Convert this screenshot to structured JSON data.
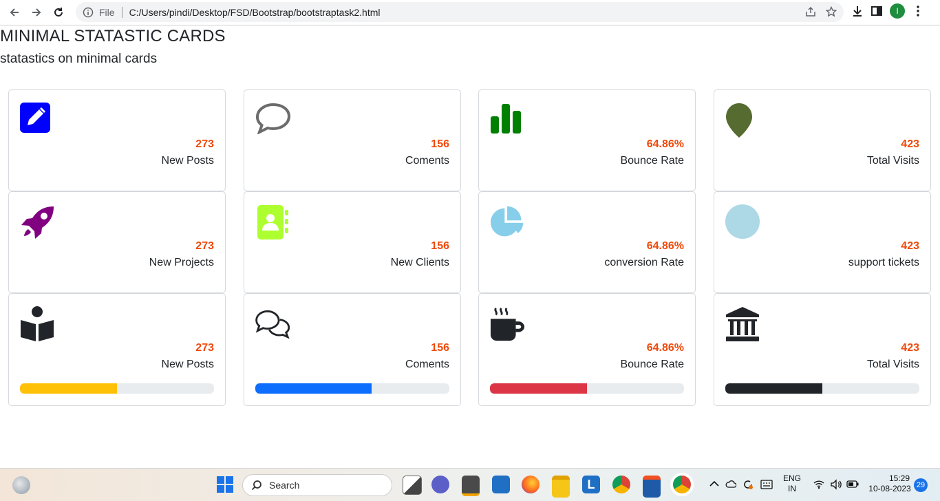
{
  "browser": {
    "file_label": "File",
    "url": "C:/Users/pindi/Desktop/FSD/Bootstrap/bootstraptask2.html",
    "profile_initial": "I"
  },
  "page": {
    "title": "MINIMAL STATASTIC CARDS",
    "subtitle": "statastics on minimal cards"
  },
  "cards": [
    {
      "icon": "pencil-square-icon",
      "value": "273",
      "label": "New Posts",
      "color": "#0000ff"
    },
    {
      "icon": "chat-bubble-icon",
      "value": "156",
      "label": "Coments",
      "color": "#6c6c6c"
    },
    {
      "icon": "bar-chart-icon",
      "value": "64.86%",
      "label": "Bounce Rate",
      "color": "#008000"
    },
    {
      "icon": "map-pin-icon",
      "value": "423",
      "label": "Total Visits",
      "color": "#556b2f"
    },
    {
      "icon": "rocket-icon",
      "value": "273",
      "label": "New Projects",
      "color": "#800080"
    },
    {
      "icon": "contact-book-icon",
      "value": "156",
      "label": "New Clients",
      "color": "#adff2f"
    },
    {
      "icon": "pie-chart-icon",
      "value": "64.86%",
      "label": "conversion Rate",
      "color": "#87ceeb"
    },
    {
      "icon": "circle-icon",
      "value": "423",
      "label": "support tickets",
      "color": "#add8e6"
    },
    {
      "icon": "reader-icon",
      "value": "273",
      "label": "New Posts",
      "color": "#212529",
      "progress": 0.5,
      "bar_color": "#ffc107"
    },
    {
      "icon": "chats-icon",
      "value": "156",
      "label": "Coments",
      "color": "#212529",
      "progress": 0.6,
      "bar_color": "#0d6efd"
    },
    {
      "icon": "coffee-cup-icon",
      "value": "64.86%",
      "label": "Bounce Rate",
      "color": "#212529",
      "progress": 0.5,
      "bar_color": "#dc3545"
    },
    {
      "icon": "bank-icon",
      "value": "423",
      "label": "Total Visits",
      "color": "#212529",
      "progress": 0.5,
      "bar_color": "#212529"
    }
  ],
  "taskbar": {
    "search_placeholder": "Search",
    "lang_top": "ENG",
    "lang_bottom": "IN",
    "time": "15:29",
    "date": "10-08-2023",
    "notifications": "29"
  }
}
